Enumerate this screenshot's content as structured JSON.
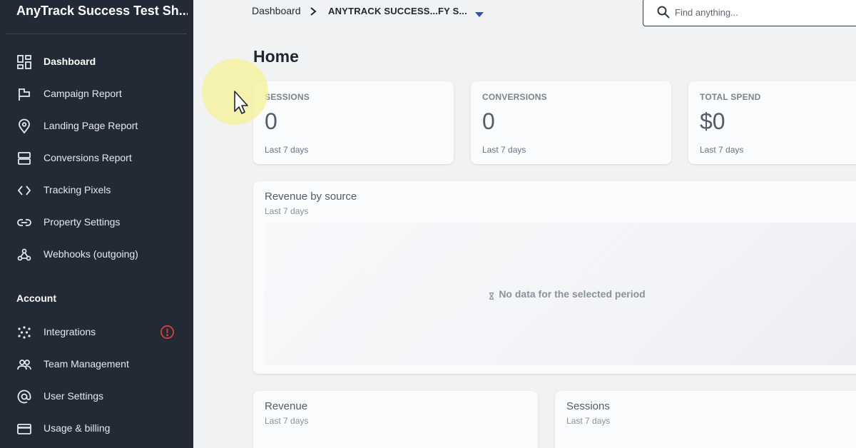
{
  "sidebar": {
    "brand": "AnyTrack Success Test Sh...",
    "items": [
      {
        "label": "Dashboard",
        "icon": "dashboard-icon",
        "active": true
      },
      {
        "label": "Campaign Report",
        "icon": "flag-icon"
      },
      {
        "label": "Landing Page Report",
        "icon": "location-pin-icon"
      },
      {
        "label": "Conversions Report",
        "icon": "stack-icon"
      },
      {
        "label": "Tracking Pixels",
        "icon": "code-icon"
      },
      {
        "label": "Property Settings",
        "icon": "link-icon"
      },
      {
        "label": "Webhooks (outgoing)",
        "icon": "webhook-icon"
      }
    ],
    "account_title": "Account",
    "account_items": [
      {
        "label": "Integrations",
        "icon": "integrations-icon",
        "alert": true
      },
      {
        "label": "Team Management",
        "icon": "team-icon"
      },
      {
        "label": "User Settings",
        "icon": "at-sign-icon"
      },
      {
        "label": "Usage & billing",
        "icon": "credit-card-icon"
      }
    ]
  },
  "topbar": {
    "breadcrumb_root": "Dashboard",
    "breadcrumb_current": "ANYTRACK SUCCESS...FY S...",
    "search_placeholder": "Find anything..."
  },
  "page": {
    "title": "Home"
  },
  "stats": [
    {
      "label": "SESSIONS",
      "value": "0",
      "sub": "Last 7 days"
    },
    {
      "label": "CONVERSIONS",
      "value": "0",
      "sub": "Last 7 days"
    },
    {
      "label": "TOTAL SPEND",
      "value": "$0",
      "sub": "Last 7 days"
    }
  ],
  "revenue_by_source": {
    "title": "Revenue by source",
    "sub": "Last 7 days",
    "empty_message": "No data for the selected period"
  },
  "revenue": {
    "title": "Revenue",
    "sub": "Last 7 days"
  },
  "sessions_card": {
    "title": "Sessions",
    "sub": "Last 7 days"
  },
  "colors": {
    "sidebar_bg": "#222a35",
    "page_bg": "#f1f2f4",
    "accent": "#2f4fb8",
    "alert": "#e0413c",
    "cursor_highlight": "#f6f296"
  }
}
